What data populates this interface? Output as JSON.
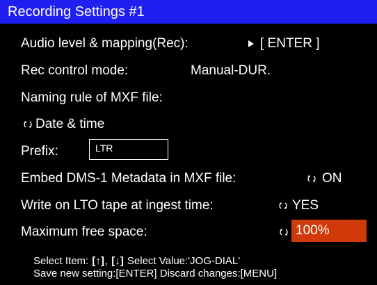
{
  "title": "Recording Settings #1",
  "rows": {
    "audio_level_label": "Audio level & mapping(Rec):",
    "audio_level_value": "[ ENTER ]",
    "rec_control_label": "Rec control mode:",
    "rec_control_value": "Manual-DUR.",
    "naming_rule_label": "Naming rule of MXF file:",
    "naming_rule_value": "Date & time",
    "prefix_label": "Prefix:",
    "prefix_value": "LTR",
    "dms_label": "Embed DMS-1 Metadata in MXF file:",
    "dms_value": "ON",
    "lto_label": "Write on LTO tape at ingest time:",
    "lto_value": "YES",
    "max_space_label": "Maximum free space:",
    "max_space_value": "100%"
  },
  "footer": {
    "select_item_label": "Select Item:",
    "up_key": "[↑]",
    "comma": ",",
    "down_key": "[↓]",
    "select_value_label": "Select Value:'JOG-DIAL'",
    "line2": "Save new setting:[ENTER] Discard changes:[MENU]"
  },
  "colors": {
    "title_bar": "#1f1ff0",
    "background": "#000000",
    "highlight": "#d03a0a",
    "text": "#ffffff"
  },
  "icons": {
    "enter_arrow": "play-triangle-icon",
    "value_cycle": "cycle-arrows-icon"
  }
}
